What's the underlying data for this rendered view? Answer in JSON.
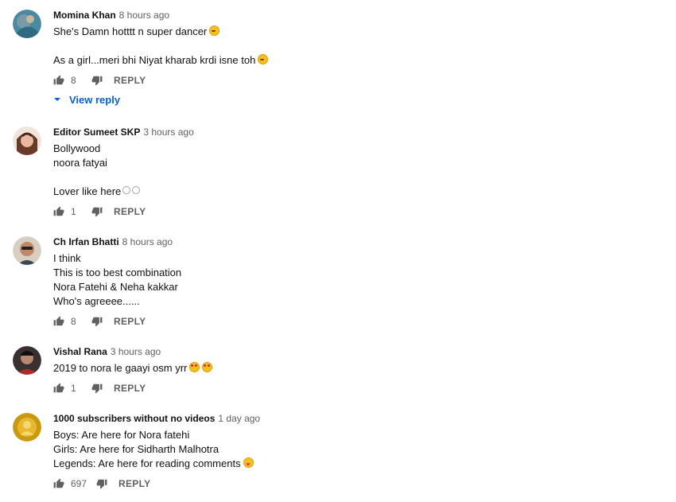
{
  "comments": [
    {
      "author": "Momina Khan",
      "time": "8 hours ago",
      "lines": [
        "She's Damn hotttt n super dancer",
        "",
        "As a girl...meri bhi Niyat kharab krdi isne toh"
      ],
      "likes": "8",
      "reply_label": "REPLY",
      "view_reply_label": "View reply",
      "avatar_color": "#4a8aa0"
    },
    {
      "author": "Editor Sumeet SKP",
      "time": "3 hours ago",
      "lines": [
        "Bollywood",
        "noora fatyai",
        "",
        "Lover like here"
      ],
      "likes": "1",
      "reply_label": "REPLY",
      "avatar_color": "#d89a7a"
    },
    {
      "author": "Ch Irfan Bhatti",
      "time": "8 hours ago",
      "lines": [
        "I think",
        "This is too best combination",
        "Nora Fatehi & Neha kakkar",
        "Who's agreeee......"
      ],
      "likes": "8",
      "reply_label": "REPLY",
      "avatar_color": "#b9a58e"
    },
    {
      "author": "Vishal Rana",
      "time": "3 hours ago",
      "lines": [
        "2019 to nora le gaayi osm yrr"
      ],
      "likes": "1",
      "reply_label": "REPLY",
      "avatar_color": "#8a3a3a"
    },
    {
      "author": "1000 subscribers without no videos",
      "time": "1 day ago",
      "lines": [
        "Boys: Are here for Nora fatehi",
        "Girls: Are here for Sidharth Malhotra",
        "Legends: Are here for reading comments"
      ],
      "likes": "697",
      "reply_label": "REPLY",
      "avatar_color": "#c99a10"
    }
  ],
  "colors": {
    "link_blue": "#065fd4",
    "meta_gray": "#606060"
  }
}
